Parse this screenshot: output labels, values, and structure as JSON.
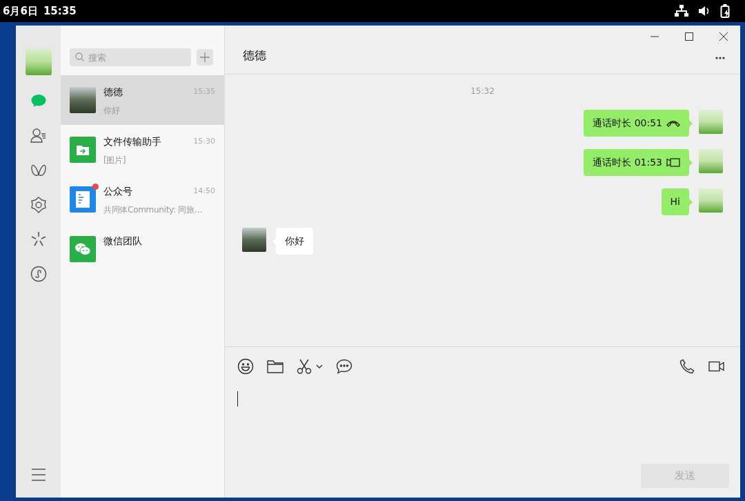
{
  "status_bar": {
    "date": "6月6日",
    "time": "15:35"
  },
  "nav": {
    "items": [
      {
        "kind": "chats",
        "selected": true
      },
      {
        "kind": "contacts",
        "selected": false
      },
      {
        "kind": "favorites",
        "selected": false
      },
      {
        "kind": "discover",
        "selected": false
      },
      {
        "kind": "search",
        "selected": false
      },
      {
        "kind": "mini-programs",
        "selected": false
      }
    ]
  },
  "search": {
    "placeholder": "搜索"
  },
  "conversations": [
    {
      "kind": "photo",
      "name": "德德",
      "time": "15:35",
      "preview": "你好",
      "selected": true,
      "unread": false
    },
    {
      "kind": "file-transfer",
      "name": "文件传输助手",
      "time": "15:30",
      "preview": "[图片]",
      "selected": false,
      "unread": false
    },
    {
      "kind": "official-accounts",
      "name": "公众号",
      "time": "14:50",
      "preview": "共同体Community: 同旅…",
      "selected": false,
      "unread": true
    },
    {
      "kind": "wechat-team",
      "name": "微信团队",
      "selected": false,
      "unread": false
    }
  ],
  "chat": {
    "title": "德德",
    "timestamp": "15:32",
    "messages": [
      {
        "outgoing": true,
        "kind": "voice-call",
        "text": "通话时长 00:51"
      },
      {
        "outgoing": true,
        "kind": "video-call",
        "text": "通话时长 01:53"
      },
      {
        "outgoing": true,
        "kind": "text",
        "text": "Hi"
      },
      {
        "outgoing": false,
        "kind": "text",
        "text": "你好"
      }
    ],
    "send_button": {
      "label": "发送",
      "disabled": true
    }
  }
}
